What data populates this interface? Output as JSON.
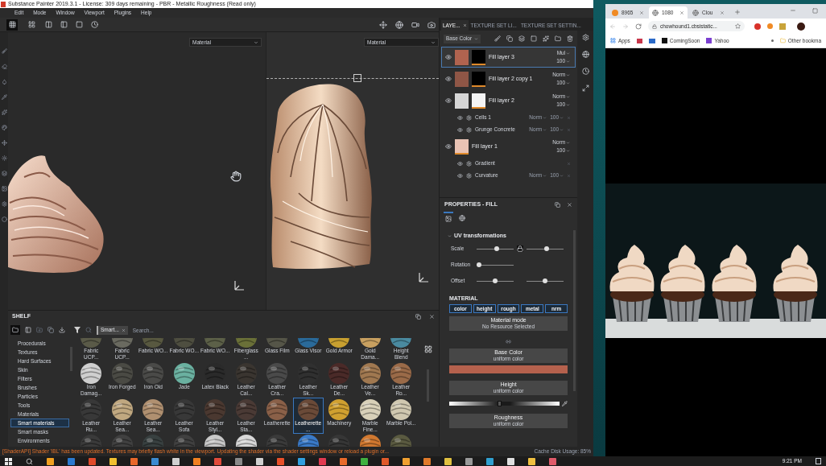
{
  "editor": {
    "title": "Substance Painter 2019.3.1 - License: 309 days remaining - PBR - Metallic Roughness (Read only)",
    "menu": [
      "Edit",
      "Mode",
      "Window",
      "Viewport",
      "Plugins",
      "Help"
    ],
    "view_modes": [
      {
        "selected": true
      },
      {
        "selected": false
      }
    ],
    "viewports": [
      {
        "dropdown": "Material"
      },
      {
        "dropdown": "Material"
      }
    ],
    "layers_panel": {
      "tabs": [
        {
          "label": "LAYE...",
          "selected": true
        },
        {
          "label": "TEXTURE SET LI...",
          "selected": false
        },
        {
          "label": "TEXTURE SET SETTIN...",
          "selected": false
        }
      ],
      "channel": "Base Color",
      "layers": [
        {
          "name": "Fill layer 3",
          "blend": "Mul",
          "opacity": "100",
          "selected": true,
          "color": "#b0634f",
          "mask": {
            "color": "#000000"
          }
        },
        {
          "name": "Fill layer 2 copy 1",
          "blend": "Norm",
          "opacity": "100",
          "selected": false,
          "color": "#8f5646",
          "mask": {
            "color": "#000000"
          }
        },
        {
          "name": "Fill layer 2",
          "blend": "Norm",
          "opacity": "100",
          "selected": false,
          "color": "#d6d6d6",
          "mask": {
            "color": "#f4f4f4"
          },
          "children": [
            {
              "name": "Cells 1",
              "blend": "Norm",
              "opacity": "100"
            },
            {
              "name": "Grunge Concrete",
              "blend": "Norm",
              "opacity": "100"
            }
          ]
        },
        {
          "name": "Fill layer 1",
          "blend": "Norm",
          "opacity": "100",
          "selected": false,
          "color": "#e9c3b4",
          "children": [
            {
              "name": "Gradient"
            },
            {
              "name": "Curvature",
              "blend": "Norm",
              "opacity": "100"
            }
          ]
        }
      ]
    },
    "properties": {
      "title": "PROPERTIES - FILL",
      "section": "UV transformations",
      "params": [
        {
          "label": "Scale",
          "locked": true,
          "sliders": [
            {
              "level": 0.55
            },
            {
              "level": 0.55
            }
          ]
        },
        {
          "label": "Rotation",
          "sliders": [
            {
              "level": 0
            }
          ]
        },
        {
          "label": "Offset",
          "sliders": [
            {
              "level": 0.5
            },
            {
              "level": 0.5
            }
          ]
        }
      ],
      "material_heading": "MATERIAL",
      "channels": [
        {
          "label": "color",
          "on": true
        },
        {
          "label": "height",
          "on": true
        },
        {
          "label": "rough",
          "on": true
        },
        {
          "label": "metal",
          "on": true
        },
        {
          "label": "nrm",
          "on": true
        }
      ],
      "mode": {
        "title": "Material mode",
        "value": "No Resource Selected"
      },
      "inputs": [
        {
          "kind": "color",
          "title": "Base Color",
          "value": "uniform color",
          "color": "#b5614d"
        },
        {
          "kind": "gradient",
          "title": "Height",
          "value": "uniform color",
          "level": 0.45
        },
        {
          "kind": "plain",
          "title": "Roughness",
          "value": "uniform color"
        }
      ]
    },
    "shelf": {
      "title": "SHELF",
      "tag": "Smart...",
      "search_placeholder": "Search...",
      "categories": [
        {
          "label": "Procedurals",
          "selected": false
        },
        {
          "label": "Textures",
          "selected": false
        },
        {
          "label": "Hard Surfaces",
          "selected": false
        },
        {
          "label": "Skin",
          "selected": false
        },
        {
          "label": "Filters",
          "selected": false
        },
        {
          "label": "Brushes",
          "selected": false
        },
        {
          "label": "Particles",
          "selected": false
        },
        {
          "label": "Tools",
          "selected": false
        },
        {
          "label": "Materials",
          "selected": false
        },
        {
          "label": "Smart materials",
          "selected": true
        },
        {
          "label": "Smart masks",
          "selected": false
        },
        {
          "label": "Environments",
          "selected": false
        }
      ],
      "materials": [
        {
          "label": "Fabric UCP...",
          "color": "#5a5a48",
          "selected": false
        },
        {
          "label": "Fabric UCP...",
          "color": "#6a6a60",
          "selected": false
        },
        {
          "label": "Fabric WO...",
          "color": "#585840",
          "selected": false
        },
        {
          "label": "Fabric WO...",
          "color": "#4e4e40",
          "selected": false
        },
        {
          "label": "Fabric WO...",
          "color": "#5c6048",
          "selected": false
        },
        {
          "label": "Fiberglass ...",
          "color": "#6a7038",
          "selected": false
        },
        {
          "label": "Glass Film",
          "color": "#555548",
          "selected": false
        },
        {
          "label": "Glass Visor",
          "color": "#2a6a9a",
          "selected": false
        },
        {
          "label": "Gold Armor",
          "color": "#c8a030",
          "selected": false
        },
        {
          "label": "Gold Dama...",
          "color": "#c8a060",
          "selected": false
        },
        {
          "label": "Height Blend",
          "color": "#4a8aa0",
          "selected": false
        },
        {
          "label": "Iron Damag...",
          "color": "#cfcfcf",
          "selected": false
        },
        {
          "label": "Iron Forged",
          "color": "#4a4a44",
          "selected": false
        },
        {
          "label": "Iron Old",
          "color": "#4a4a48",
          "selected": false
        },
        {
          "label": "Jade",
          "color": "#6ab0a0",
          "selected": false
        },
        {
          "label": "Latex Black",
          "color": "#2a2a2a",
          "selected": false
        },
        {
          "label": "Leather Cal...",
          "color": "#3a3530",
          "selected": false
        },
        {
          "label": "Leather Cra...",
          "color": "#4a4a4a",
          "selected": false
        },
        {
          "label": "Leather Sk...",
          "color": "#303030",
          "selected": false
        },
        {
          "label": "Leather De...",
          "color": "#4a2a28",
          "selected": false
        },
        {
          "label": "Leather Ve...",
          "color": "#a07850",
          "selected": false
        },
        {
          "label": "Leather Ro...",
          "color": "#9a6a48",
          "selected": false
        },
        {
          "label": "Leather Ru...",
          "color": "#383838",
          "selected": false
        },
        {
          "label": "Leather Sea...",
          "color": "#c0a880",
          "selected": false
        },
        {
          "label": "Leather Sea...",
          "color": "#b09070",
          "selected": false
        },
        {
          "label": "Leather Sofa",
          "color": "#383838",
          "selected": false
        },
        {
          "label": "Leather Styl...",
          "color": "#4a3830",
          "selected": false
        },
        {
          "label": "Leather Sta...",
          "color": "#4a3a35",
          "selected": false
        },
        {
          "label": "Leatherette",
          "color": "#8a6048",
          "selected": false
        },
        {
          "label": "Leatherette ...",
          "color": "#6a4a38",
          "selected": true
        },
        {
          "label": "Machinery",
          "color": "#d0a030",
          "selected": false
        },
        {
          "label": "Marble Fine...",
          "color": "#d8d0b8",
          "selected": false
        },
        {
          "label": "Marble Pol...",
          "color": "#d0c8b0",
          "selected": false
        },
        {
          "color": "#3a3a3a",
          "selected": false
        },
        {
          "color": "#404040",
          "selected": false
        },
        {
          "color": "#384040",
          "selected": false
        },
        {
          "color": "#404040",
          "selected": false
        },
        {
          "color": "#c8c8c8",
          "selected": false
        },
        {
          "color": "#d8d8d8",
          "selected": false
        },
        {
          "color": "#3a3a3a",
          "selected": false
        },
        {
          "color": "#3a7ac8",
          "selected": false
        },
        {
          "color": "#363636",
          "selected": false
        },
        {
          "color": "#d07830",
          "selected": false
        },
        {
          "color": "#5a5a40",
          "selected": false
        }
      ]
    },
    "status_bar": {
      "message": "[ShaderAPI] Shader 'iBL' has been updated. Textures may briefly flash white in the viewport. Updating the shader via the shader settings window or reload a plugin or...",
      "cache": "Cache Disk Usage: 85%"
    }
  },
  "browser": {
    "tabs": [
      {
        "title": "8965",
        "kind": "site",
        "selected": false
      },
      {
        "title": "1080",
        "kind": "globe",
        "selected": true
      },
      {
        "title": "Clou",
        "kind": "globe",
        "selected": false
      }
    ],
    "url": "chowhound1.cbsistatic...",
    "bookmarks": [
      {
        "label": "Apps",
        "kind": "apps"
      },
      {
        "label": "ComingSoon",
        "kind": "dark"
      },
      {
        "label": "Yahoo",
        "kind": "purple"
      }
    ],
    "other_bookmarks": "Other bookma"
  },
  "taskbar": {
    "time": "9:21 PM"
  }
}
